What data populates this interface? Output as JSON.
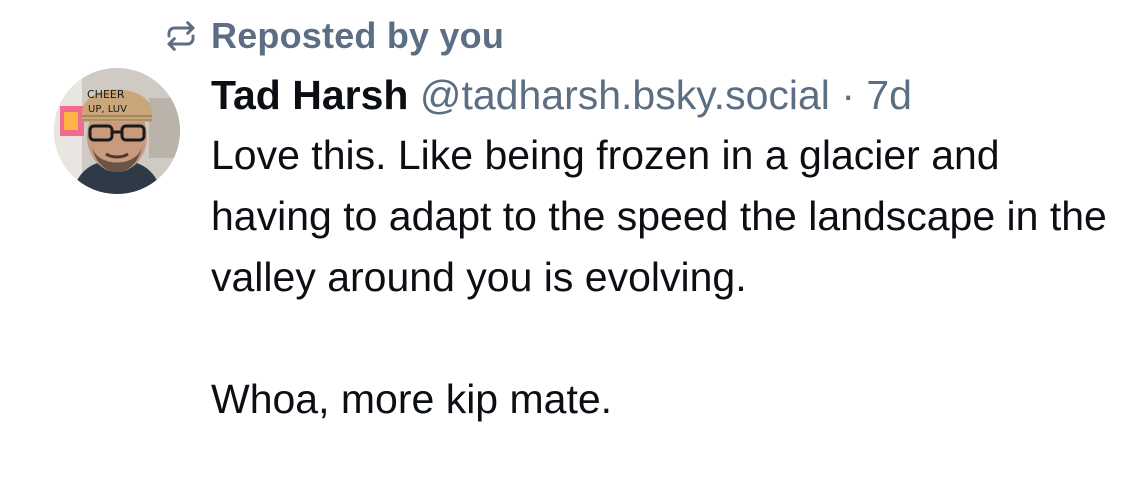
{
  "repost": {
    "icon": "repost-icon",
    "label": "Reposted by you",
    "color": "#5c6e83"
  },
  "author": {
    "display_name": "Tad Harsh",
    "handle": "@tadharsh.bsky.social",
    "separator": "·",
    "timestamp": "7d",
    "avatar_hat_text_line1": "CHEER",
    "avatar_hat_text_line2": "UP, LUV"
  },
  "post": {
    "paragraphs": [
      "Love this. Like being frozen in a glacier and having to adapt to the speed the landscape in the valley around you is evolving.",
      "Whoa, more kip mate."
    ]
  },
  "colors": {
    "text_primary": "#0b0f14",
    "text_secondary": "#5c6e83",
    "background": "#ffffff"
  }
}
